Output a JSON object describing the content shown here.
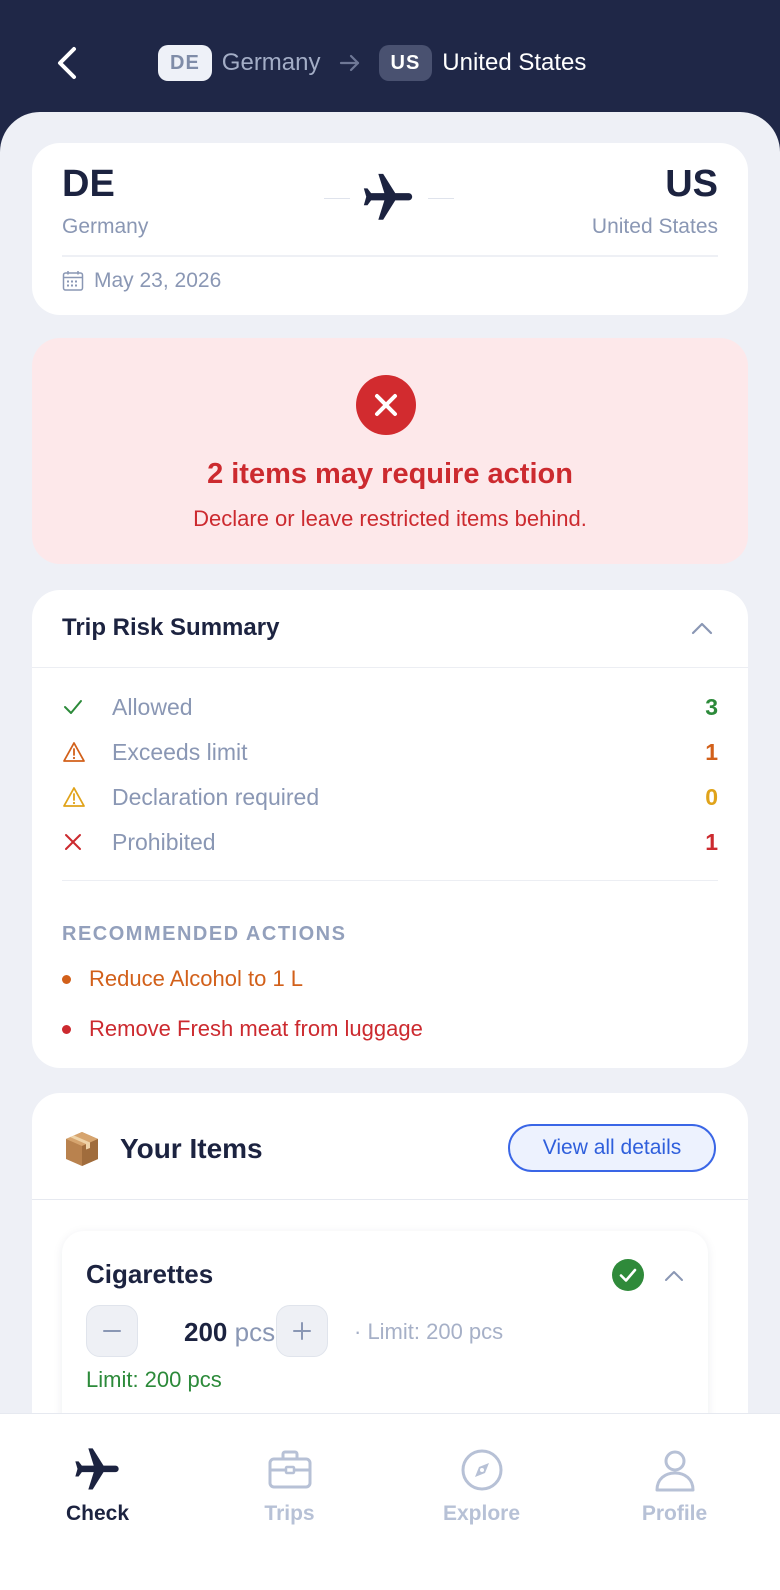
{
  "header": {
    "from_code": "DE",
    "from_name": "Germany",
    "to_code": "US",
    "to_name": "United States"
  },
  "trip": {
    "from_code": "DE",
    "from_name": "Germany",
    "to_code": "US",
    "to_name": "United States",
    "date": "May 23, 2026"
  },
  "alert": {
    "title": "2 items may require action",
    "subtitle": "Declare or leave restricted items behind."
  },
  "risk": {
    "title": "Trip Risk Summary",
    "rows": [
      {
        "label": "Allowed",
        "count": "3",
        "color": "#2c8a3a",
        "icon": "check-icon"
      },
      {
        "label": "Exceeds limit",
        "count": "1",
        "color": "#d2601a",
        "icon": "warning-icon"
      },
      {
        "label": "Declaration required",
        "count": "0",
        "color": "#e0a31a",
        "icon": "warning-icon"
      },
      {
        "label": "Prohibited",
        "count": "1",
        "color": "#cc2a2f",
        "icon": "x-icon"
      }
    ],
    "recommended_heading": "RECOMMENDED ACTIONS",
    "actions": [
      {
        "text": "Reduce Alcohol to 1 L",
        "color": "#d2601a"
      },
      {
        "text": "Remove Fresh meat from luggage",
        "color": "#cc2a2f"
      }
    ]
  },
  "items": {
    "title": "Your Items",
    "view_all": "View all details",
    "list": [
      {
        "name": "Cigarettes",
        "quantity": "200",
        "unit": "pcs",
        "limit_inline": "· Limit: 200 pcs",
        "limit_status": "Limit: 200 pcs"
      }
    ]
  },
  "tabs": [
    {
      "label": "Check",
      "icon": "plane-icon",
      "active": true
    },
    {
      "label": "Trips",
      "icon": "briefcase-icon",
      "active": false
    },
    {
      "label": "Explore",
      "icon": "compass-icon",
      "active": false
    },
    {
      "label": "Profile",
      "icon": "person-icon",
      "active": false
    }
  ],
  "colors": {
    "navy": "#1f2747",
    "danger": "#cc2a2f",
    "success": "#2c8a3a",
    "accent": "#3a66e6"
  }
}
